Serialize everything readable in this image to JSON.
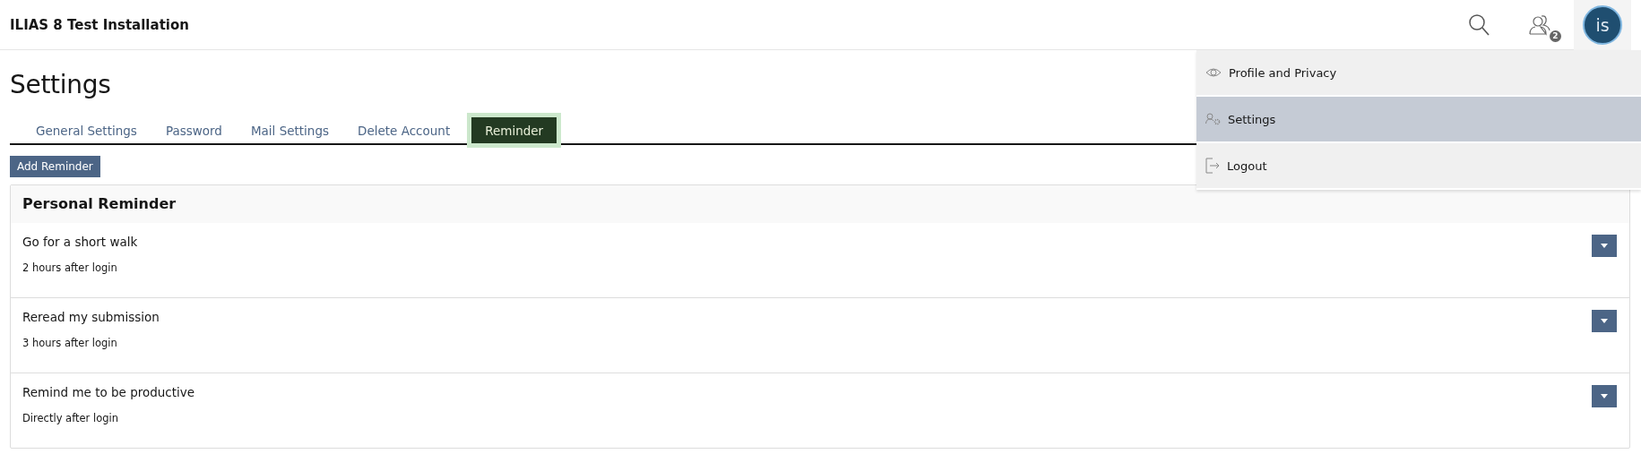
{
  "header": {
    "title": "ILIAS 8 Test Installation",
    "notification_count": "2",
    "avatar_initials": "is"
  },
  "user_menu": {
    "items": [
      {
        "label": "Profile and Privacy",
        "kind": "eye",
        "selected": false
      },
      {
        "label": "Settings",
        "kind": "user-gear",
        "selected": true
      },
      {
        "label": "Logout",
        "kind": "logout",
        "selected": false
      }
    ]
  },
  "page": {
    "title": "Settings"
  },
  "tabs": [
    {
      "label": "General Settings",
      "selected": false
    },
    {
      "label": "Password",
      "selected": false
    },
    {
      "label": "Mail Settings",
      "selected": false
    },
    {
      "label": "Delete Account",
      "selected": false
    },
    {
      "label": "Reminder",
      "selected": true
    }
  ],
  "add_button": "Add Reminder",
  "panel": {
    "title": "Personal Reminder",
    "items": [
      {
        "title": "Go for a short walk",
        "timing": "2 hours after login"
      },
      {
        "title": "Reread my submission",
        "timing": "3 hours after login"
      },
      {
        "title": "Remind me to be productive",
        "timing": "Directly after login"
      }
    ]
  }
}
